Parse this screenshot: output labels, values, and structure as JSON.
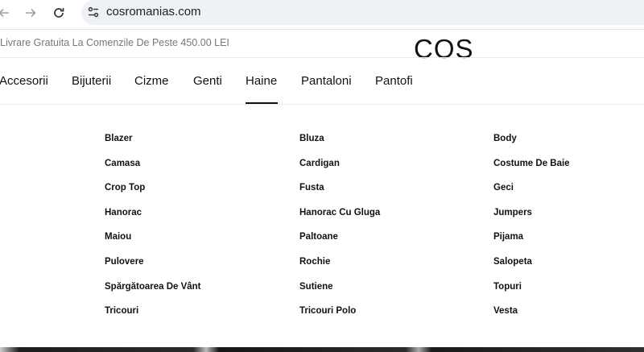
{
  "browser": {
    "url": "cosromanias.com",
    "back_icon": "arrow-left-icon",
    "forward_icon": "arrow-right-icon",
    "reload_icon": "reload-icon",
    "site_info_icon": "tune-icon"
  },
  "header": {
    "promo": "Livrare Gratuita La Comenzile De Peste 450.00 LEI",
    "logo": "COS"
  },
  "nav": {
    "categories": [
      "Accesorii",
      "Bijuterii",
      "Cizme",
      "Genti",
      "Haine",
      "Pantaloni",
      "Pantofi"
    ],
    "active": "Haine"
  },
  "menu": {
    "columns": [
      [
        "Blazer",
        "Camasa",
        "Crop Top",
        "Hanorac",
        "Maiou",
        "Pulovere",
        "Spărgătoarea De Vânt",
        "Tricouri"
      ],
      [
        "Bluza",
        "Cardigan",
        "Fusta",
        "Hanorac Cu Gluga",
        "Paltoane",
        "Rochie",
        "Sutiene",
        "Tricouri Polo"
      ],
      [
        "Body",
        "Costume De Baie",
        "Geci",
        "Jumpers",
        "Pijama",
        "Salopeta",
        "Topuri",
        "Vesta"
      ]
    ]
  }
}
